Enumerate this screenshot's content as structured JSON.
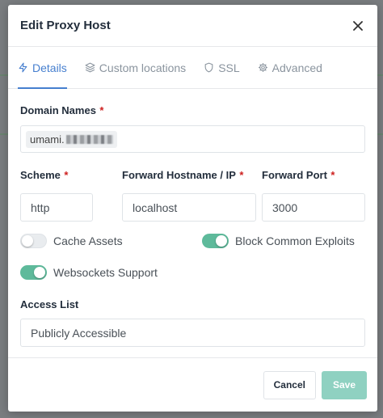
{
  "modal": {
    "title": "Edit Proxy Host",
    "close_icon": "close-icon"
  },
  "tabs": [
    {
      "label": "Details",
      "icon": "lightning-icon",
      "active": true
    },
    {
      "label": "Custom locations",
      "icon": "layers-icon",
      "active": false
    },
    {
      "label": "SSL",
      "icon": "shield-icon",
      "active": false
    },
    {
      "label": "Advanced",
      "icon": "gear-icon",
      "active": false
    }
  ],
  "form": {
    "domain_names": {
      "label": "Domain Names",
      "required_mark": "*",
      "chip_value": "umami."
    },
    "scheme": {
      "label": "Scheme",
      "required_mark": "*",
      "value": "http"
    },
    "forward_hostname": {
      "label": "Forward Hostname / IP",
      "required_mark": "*",
      "value": "localhost"
    },
    "forward_port": {
      "label": "Forward Port",
      "required_mark": "*",
      "value": "3000"
    },
    "cache_assets": {
      "label": "Cache Assets",
      "enabled": false
    },
    "block_exploits": {
      "label": "Block Common Exploits",
      "enabled": true
    },
    "websockets": {
      "label": "Websockets Support",
      "enabled": true
    },
    "access_list": {
      "label": "Access List",
      "value": "Publicly Accessible"
    }
  },
  "footer": {
    "cancel_label": "Cancel",
    "save_label": "Save"
  },
  "colors": {
    "accent": "#467fcf",
    "toggle_on": "#5eba9b",
    "save_button": "#8fd1c1",
    "required": "#cd201f"
  }
}
